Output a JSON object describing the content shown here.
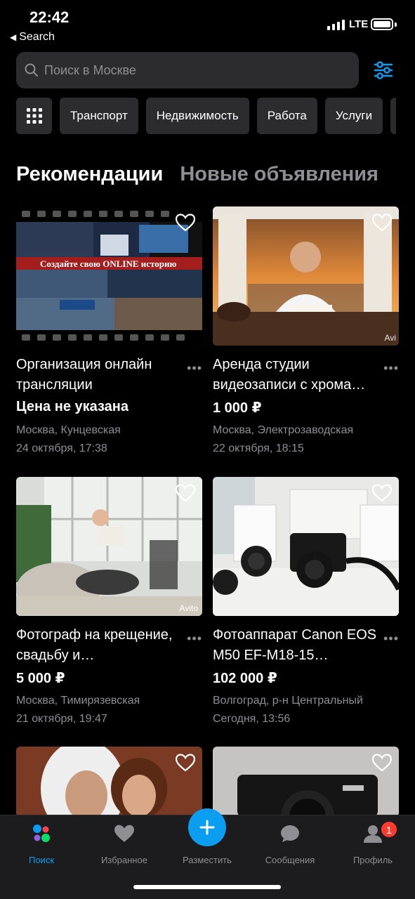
{
  "status": {
    "time": "22:42",
    "back_label": "Search",
    "network": "LTE"
  },
  "search": {
    "placeholder": "Поиск в Москве"
  },
  "categories": [
    "Транспорт",
    "Недвижимость",
    "Работа",
    "Услуги"
  ],
  "sections": {
    "active": "Рекомендации",
    "inactive": "Новые объявления"
  },
  "listings": [
    {
      "title": "Организация онлайн трансляции",
      "price": "Цена не указана",
      "location": "Москва, Кунцевская",
      "date": "24 октября, 17:38",
      "banner": "Создайте свою ONLINE историю"
    },
    {
      "title": "Аренда студии видеозаписи с хрома…",
      "price": "1 000 ₽",
      "location": "Москва, Электрозаводская",
      "date": "22 октября, 18:15",
      "watermark": "Avi"
    },
    {
      "title": "Фотограф на крещение, свадьбу и…",
      "price": "5 000 ₽",
      "location": "Москва, Тимирязевская",
      "date": "21 октября, 19:47",
      "watermark": "Avito"
    },
    {
      "title": "Фотоаппарат Canon EOS M50 EF-M18-15…",
      "price": "102 000 ₽",
      "location": "Волгоград, р-н Центральный",
      "date": "Сегодня, 13:56"
    }
  ],
  "tabbar": {
    "search": "Поиск",
    "favorites": "Избранное",
    "post": "Разместить",
    "messages": "Сообщения",
    "profile": "Профиль",
    "profile_badge": "1"
  },
  "colors": {
    "accent": "#0a9df0",
    "badge": "#ff3b30",
    "background": "#000000",
    "chip": "#2c2c2e"
  }
}
